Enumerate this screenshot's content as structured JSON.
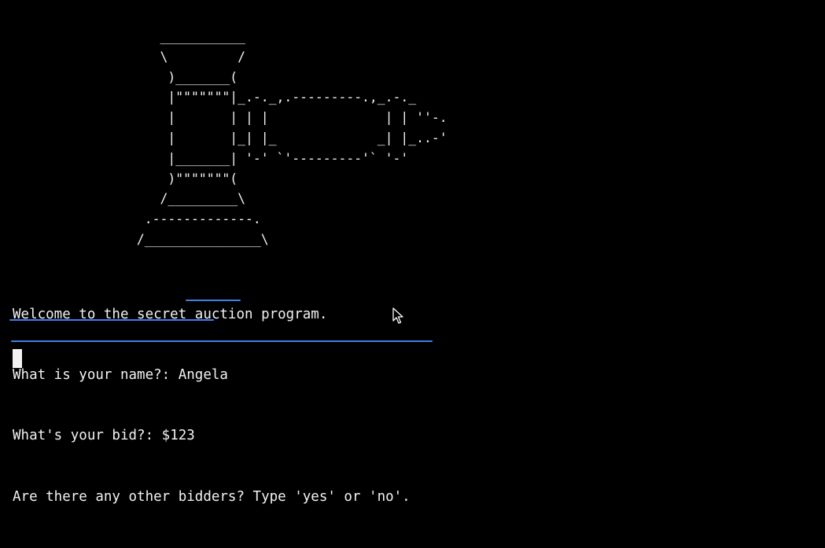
{
  "terminal": {
    "ascii_art": [
      "                   ___________",
      "                   \\         /",
      "                    )_______(",
      "                    |\"\"\"\"\"\"\"|_.-._,.---------.,_.-._",
      "                    |       | | |               | | ''-.",
      "                    |       |_| |_             _| |_..-'",
      "                    |_______| '-' `'---------'` '-'",
      "                    )\"\"\"\"\"\"\"(",
      "                   /_________\\",
      "                 .-------------.",
      "                /_______________\\"
    ],
    "welcome": "Welcome to the secret auction program.",
    "name_prompt": "What is your name?: ",
    "name_value": "Angela",
    "bid_prompt": "What's your bid?: ",
    "bid_value": "$123",
    "others_prompt": "Are there any other bidders? Type 'yes' or 'no'.",
    "underline_color": "#3f7fe8"
  }
}
